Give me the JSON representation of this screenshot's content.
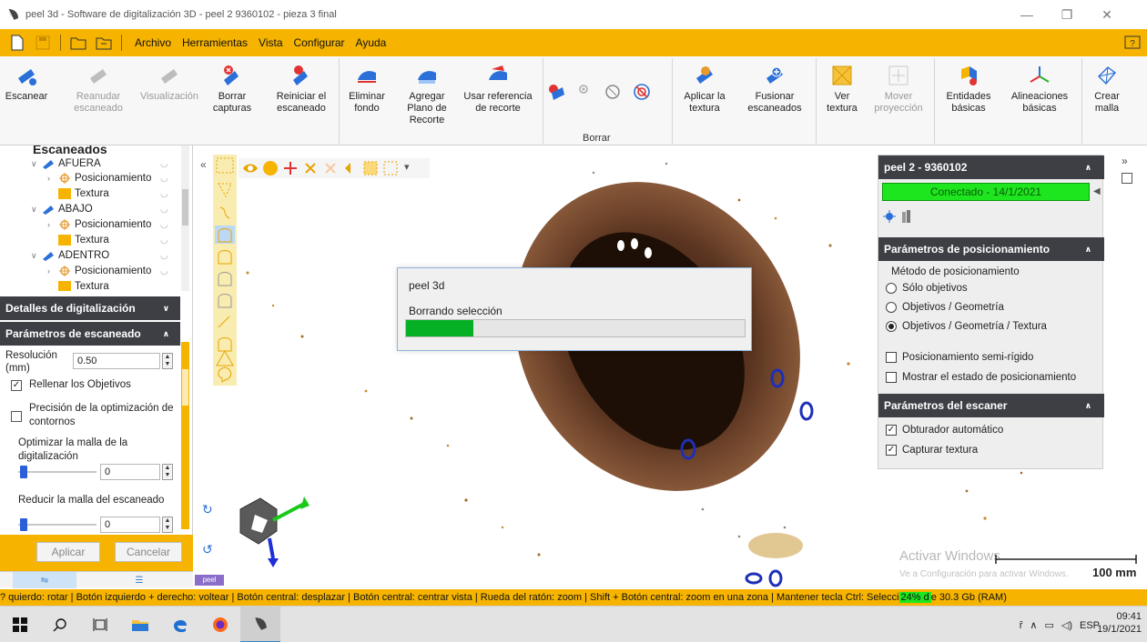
{
  "window": {
    "title": "peel 3d - Software de digitalización 3D - peel 2 9360102 - pieza 3 final",
    "minimize": "—",
    "maximize": "❐",
    "close": "✕"
  },
  "menu": [
    "Archivo",
    "Herramientas",
    "Vista",
    "Configurar",
    "Ayuda"
  ],
  "ribbon": {
    "scan": "Escanear",
    "resume": "Reanudar\nescaneado",
    "visualization": "Visualización",
    "delete_captures": "Borrar\ncapturas",
    "restart_scan": "Reiniciar el\nescaneado",
    "remove_background": "Eliminar\nfondo",
    "add_clip_plane": "Agregar\nPlano de\nRecorte",
    "use_clip_ref": "Usar referencia\nde recorte",
    "apply_texture": "Aplicar la\ntextura",
    "merge_scans": "Fusionar\nescaneados",
    "view_texture": "Ver\ntextura",
    "move_projection": "Mover\nproyección",
    "basic_entities": "Entidades\nbásicas",
    "basic_alignments": "Alineaciones\nbásicas",
    "create_mesh": "Crear\nmalla",
    "group_delete": "Borrar"
  },
  "tree": {
    "heading": "Escaneados",
    "items": [
      {
        "label": "AFUERA",
        "kind": "scan"
      },
      {
        "label": "Posicionamiento",
        "kind": "position"
      },
      {
        "label": "Textura",
        "kind": "texture"
      },
      {
        "label": "ABAJO",
        "kind": "scan"
      },
      {
        "label": "Posicionamiento",
        "kind": "position"
      },
      {
        "label": "Textura",
        "kind": "texture"
      },
      {
        "label": "ADENTRO",
        "kind": "scan"
      },
      {
        "label": "Posicionamiento",
        "kind": "position"
      },
      {
        "label": "Textura",
        "kind": "texture"
      }
    ]
  },
  "left_panel": {
    "details_header": "Detalles de digitalización",
    "params_header": "Parámetros de escaneado",
    "resolution_label": "Resolución (mm)",
    "resolution_value": "0.50",
    "fill_targets": "Rellenar los Objetivos",
    "contour_precision": "Precisión de la optimización de contornos",
    "optimize_mesh": "Optimizar la malla de la digitalización",
    "optimize_value": "0",
    "reduce_mesh": "Reducir la malla del escaneado",
    "reduce_value": "0",
    "apply": "Aplicar",
    "cancel": "Cancelar"
  },
  "viewport": {
    "watermark_title": "Activar Windows",
    "watermark_sub": "Ve a Configuración para activar Windows.",
    "scale": "100 mm",
    "brand_tag": "peel"
  },
  "right_dock": {
    "device": "peel 2 - 9360102",
    "status": "Conectado - 14/1/2021",
    "positioning_header": "Parámetros de posicionamiento",
    "method_label": "Método de posicionamiento",
    "method_options": [
      "Sólo objetivos",
      "Objetivos / Geometría",
      "Objetivos / Geometría / Textura"
    ],
    "method_selected": 2,
    "semi_rigid": "Posicionamiento semi-rígido",
    "show_state": "Mostrar el estado de posicionamiento",
    "scanner_header": "Parámetros del escaner",
    "auto_shutter": "Obturador automático",
    "capture_texture": "Capturar textura"
  },
  "dialog": {
    "title": "peel 3d",
    "message": "Borrando selección",
    "progress": 0.2
  },
  "hint": {
    "text": "? quierdo: rotar | Botón izquierdo + derecho: voltear | Botón central: desplazar | Botón central: centrar vista | Rueda del ratón: zoom | Shift + Botón central: zoom en una zona | Mantener tecla Ctrl: Selecci",
    "ram_pct": "24% d",
    "ram_rest": "e 30.3 Gb (RAM)"
  },
  "taskbar": {
    "language": "ESP",
    "time": "09:41",
    "date": "19/1/2021"
  },
  "colors": {
    "accent": "#f6b400",
    "panel_header": "#3d3f45",
    "connected": "#1ee61e",
    "progress": "#06b025"
  }
}
